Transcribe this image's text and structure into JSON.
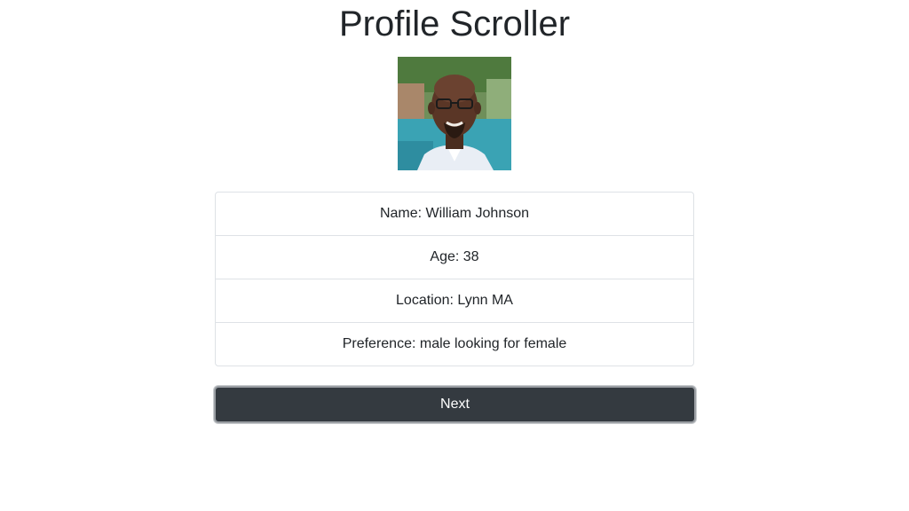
{
  "page": {
    "title": "Profile Scroller"
  },
  "profile": {
    "photo_icon": "profile-photo",
    "fields": [
      {
        "text": "Name: William Johnson"
      },
      {
        "text": "Age: 38"
      },
      {
        "text": "Location: Lynn MA"
      },
      {
        "text": "Preference: male looking for female"
      }
    ]
  },
  "actions": {
    "next_label": "Next"
  },
  "colors": {
    "button_bg": "#343a40",
    "button_text": "#ffffff",
    "border": "#dee2e6",
    "text": "#212529"
  }
}
